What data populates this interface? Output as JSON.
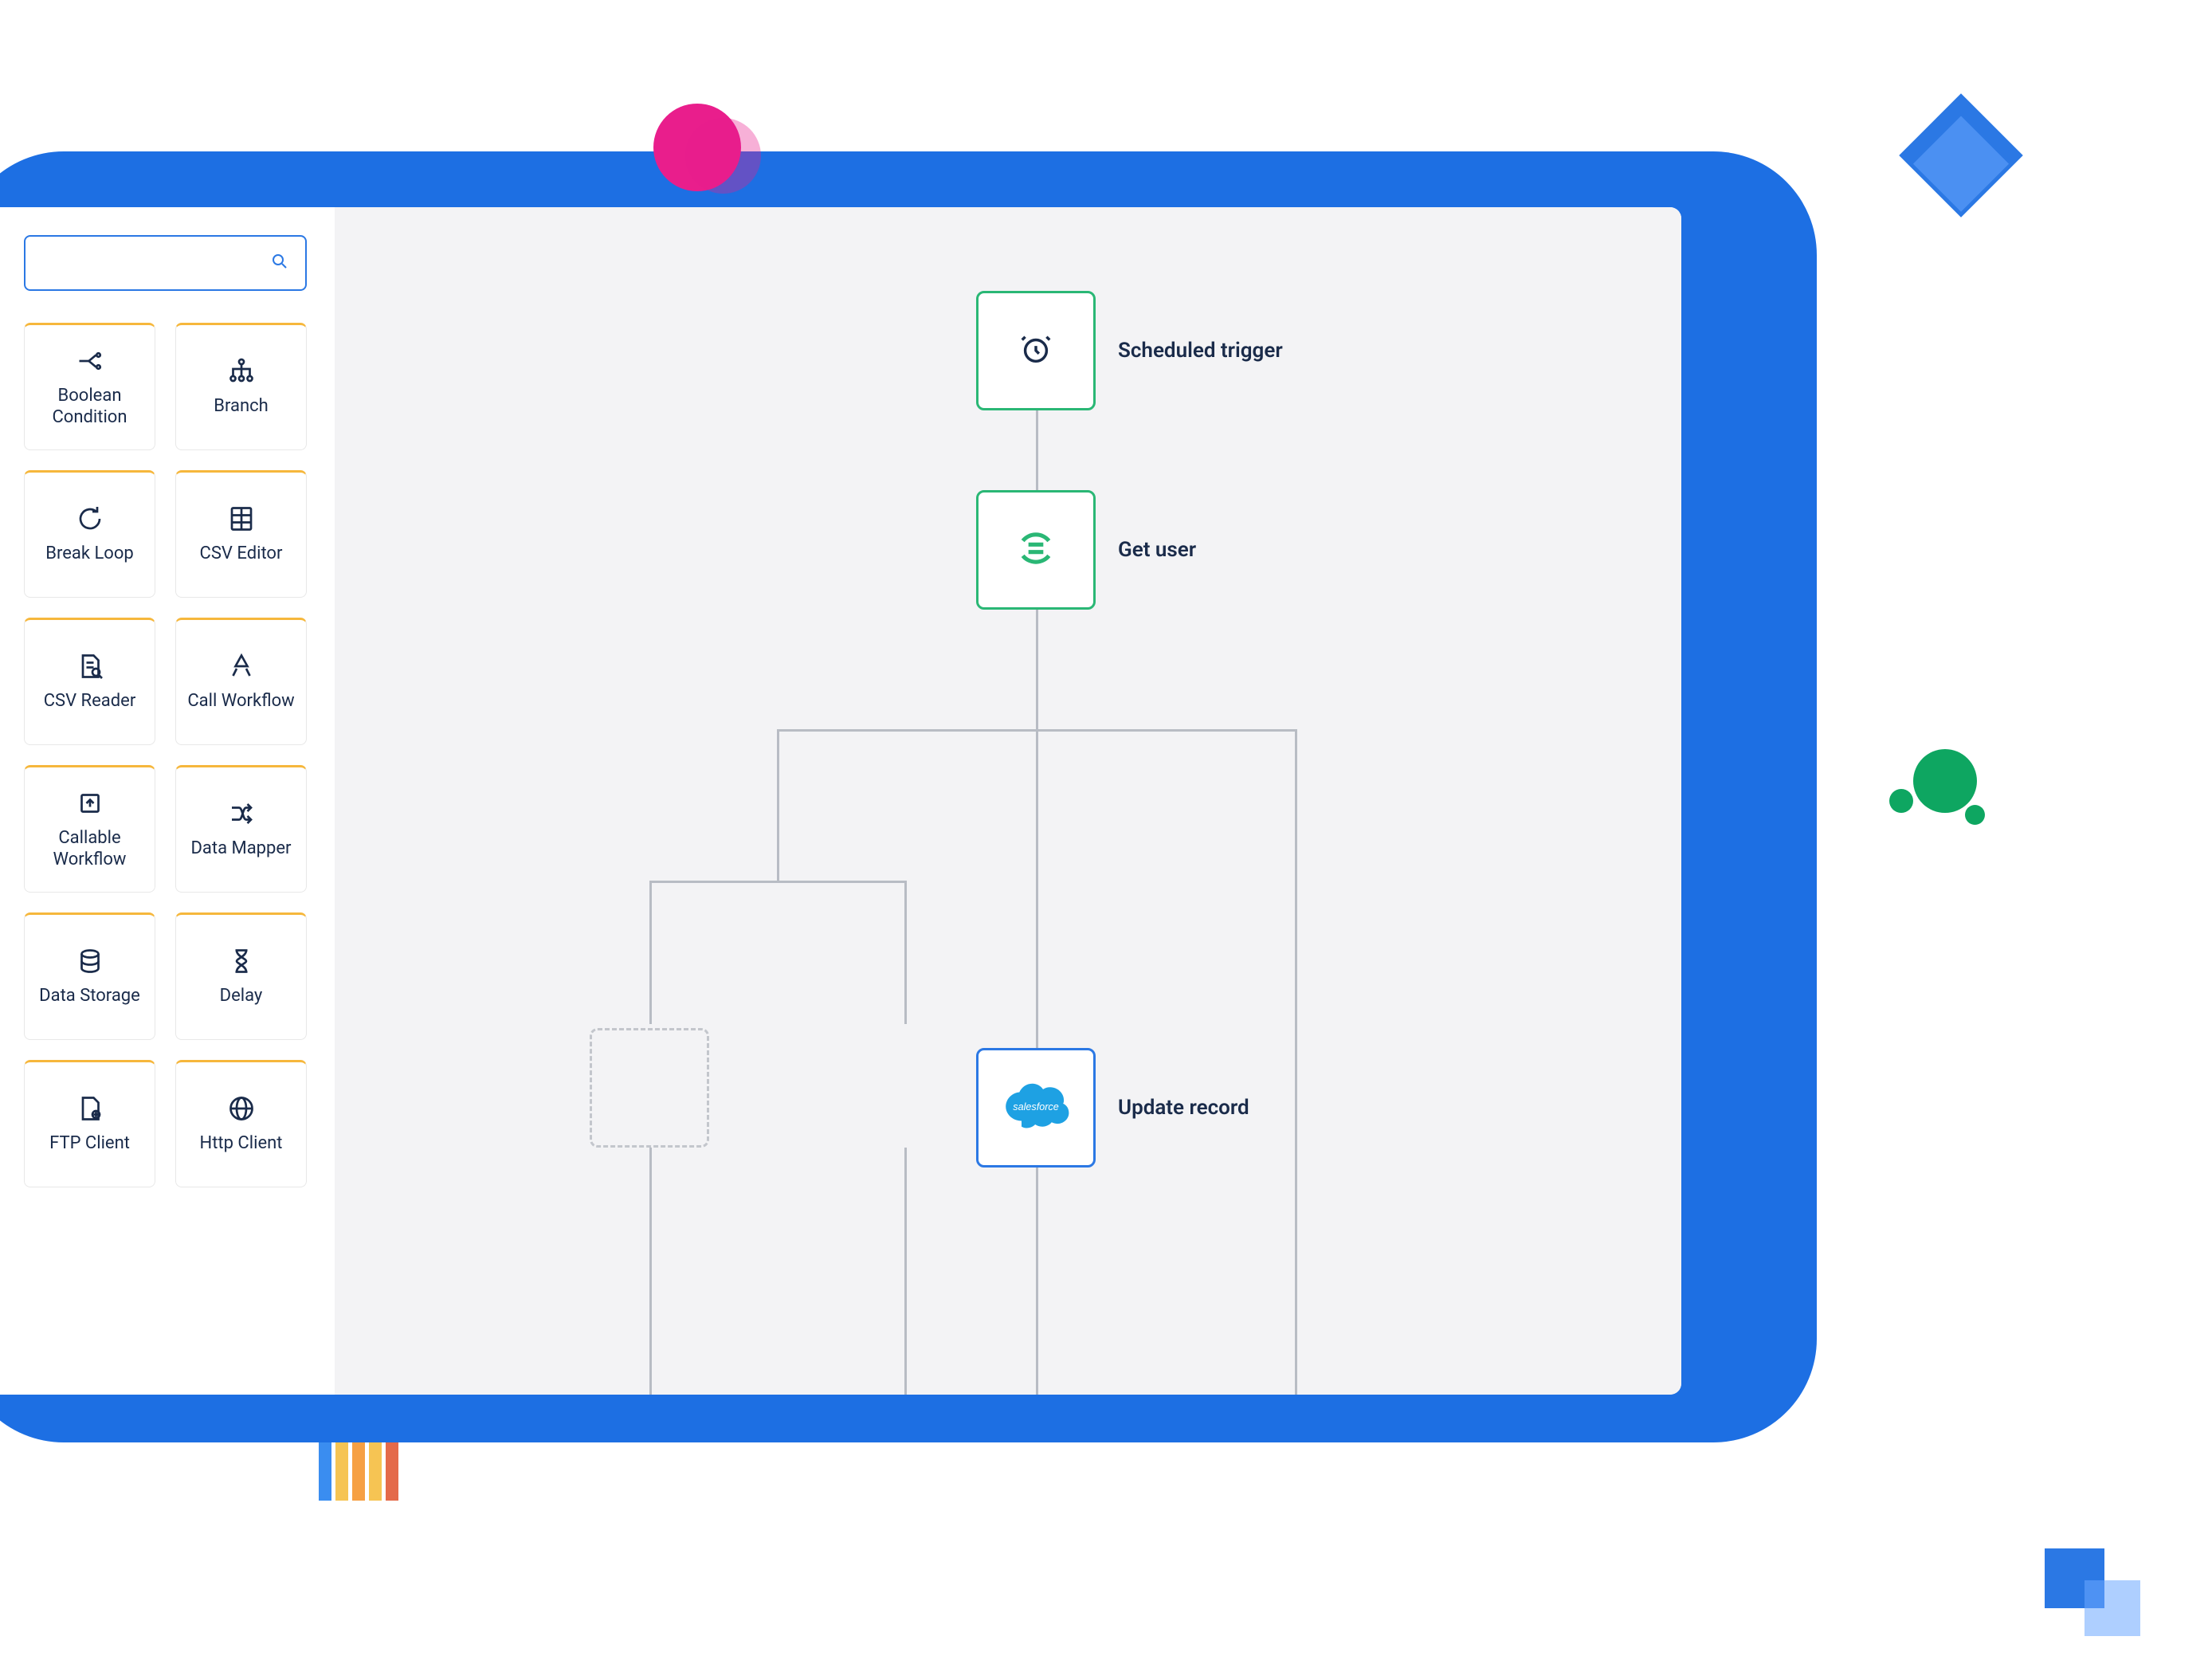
{
  "search": {
    "placeholder": ""
  },
  "palette": [
    {
      "label": "Boolean Condition"
    },
    {
      "label": "Branch"
    },
    {
      "label": "Break Loop"
    },
    {
      "label": "CSV Editor"
    },
    {
      "label": "CSV Reader"
    },
    {
      "label": "Call Workflow"
    },
    {
      "label": "Callable Workflow"
    },
    {
      "label": "Data Mapper"
    },
    {
      "label": "Data Storage"
    },
    {
      "label": "Delay"
    },
    {
      "label": "FTP Client"
    },
    {
      "label": "Http Client"
    }
  ],
  "workflow": {
    "nodes": {
      "trigger": {
        "label": "Scheduled trigger"
      },
      "getuser": {
        "label": "Get user"
      },
      "update": {
        "label": "Update record"
      }
    }
  },
  "colors": {
    "primary_blue": "#1d6fe3",
    "accent_green": "#2ab775",
    "accent_orange": "#f6b73c",
    "pink": "#e91e8c"
  }
}
